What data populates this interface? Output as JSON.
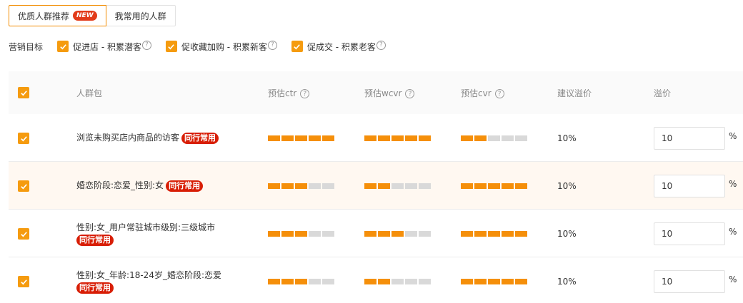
{
  "tabs": [
    {
      "label": "优质人群推荐",
      "badge": "NEW"
    },
    {
      "label": "我常用的人群"
    }
  ],
  "goals": {
    "label": "营销目标",
    "items": [
      {
        "label": "促进店 - 积累潜客",
        "help": "?"
      },
      {
        "label": "促收藏加购 - 积累新客",
        "help": "?"
      },
      {
        "label": "促成交 - 积累老客",
        "help": "?"
      }
    ]
  },
  "table": {
    "headers": {
      "name": "人群包",
      "ctr": "预估ctr",
      "wcvr": "预估wcvr",
      "cvr": "预估cvr",
      "suggested": "建议溢价",
      "premium": "溢价",
      "help": "?"
    },
    "rows": [
      {
        "name_line1": "浏览未购买店内商品的访客",
        "name_line2": "",
        "tag": "同行常用",
        "ctr": 5,
        "wcvr": 5,
        "cvr": 2,
        "suggested": "10%",
        "premium": "10",
        "unit": "%"
      },
      {
        "name_line1": "婚恋阶段:恋爱_性别:女",
        "name_line2": "",
        "tag": "同行常用",
        "ctr": 3,
        "wcvr": 2,
        "cvr": 5,
        "suggested": "10%",
        "premium": "10",
        "unit": "%"
      },
      {
        "name_line1": "性别:女_用户常驻城市级别:三级城市",
        "name_line2": "",
        "tag": "同行常用",
        "ctr": 3,
        "wcvr": 3,
        "cvr": 5,
        "suggested": "10%",
        "premium": "10",
        "unit": "%"
      },
      {
        "name_line1": "性别:女_年龄:18-24岁_婚恋阶段:恋爱",
        "name_line2": "",
        "tag": "同行常用",
        "ctr": 3,
        "wcvr": 2,
        "cvr": 5,
        "suggested": "10%",
        "premium": "10",
        "unit": "%"
      }
    ]
  },
  "colors": {
    "accent": "#f59b0f",
    "tag": "#d81e06",
    "bar_on": "#f58f0a",
    "bar_off": "#d9d9d9"
  }
}
